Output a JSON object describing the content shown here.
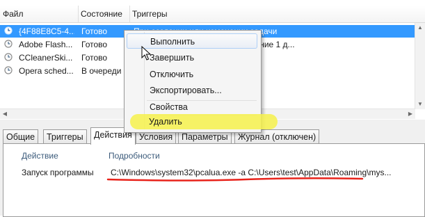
{
  "columns": {
    "file": "Файл",
    "state": "Состояние",
    "triggers": "Триггеры"
  },
  "tasks": [
    {
      "name": "{4F88E8C5-4...",
      "state": "Готово",
      "trigger": "При создании или изменении задачи"
    },
    {
      "name": "Adobe Flash...",
      "state": "Готово",
      "trigger": "автора после начала: 1 ч. в течение 1 д..."
    },
    {
      "name": "CCleanerSki...",
      "state": "Готово",
      "trigger": ""
    },
    {
      "name": "Opera sched...",
      "state": "В очереди",
      "trigger": ""
    }
  ],
  "context_menu": {
    "run": "Выполнить",
    "end": "Завершить",
    "disable": "Отключить",
    "export": "Экспортировать...",
    "properties": "Свойства",
    "delete": "Удалить"
  },
  "tabs": [
    "Общие",
    "Триггеры",
    "Действия",
    "Условия",
    "Параметры",
    "Журнал (отключен)"
  ],
  "details": {
    "header_action": "Действие",
    "header_details": "Подробности",
    "action": "Запуск программы",
    "path": "C:\\Windows\\system32\\pcalua.exe -a C:\\Users\\test\\AppData\\Roaming\\mys..."
  },
  "colors": {
    "selection": "#3399ff",
    "annotation_underline": "#e8231b",
    "annotation_highlight": "#f6f14b"
  },
  "icons": [
    "task-clock-icon",
    "mouse-cursor-icon",
    "scroll-up-icon",
    "scroll-down-icon",
    "scroll-left-icon",
    "scroll-right-icon"
  ]
}
